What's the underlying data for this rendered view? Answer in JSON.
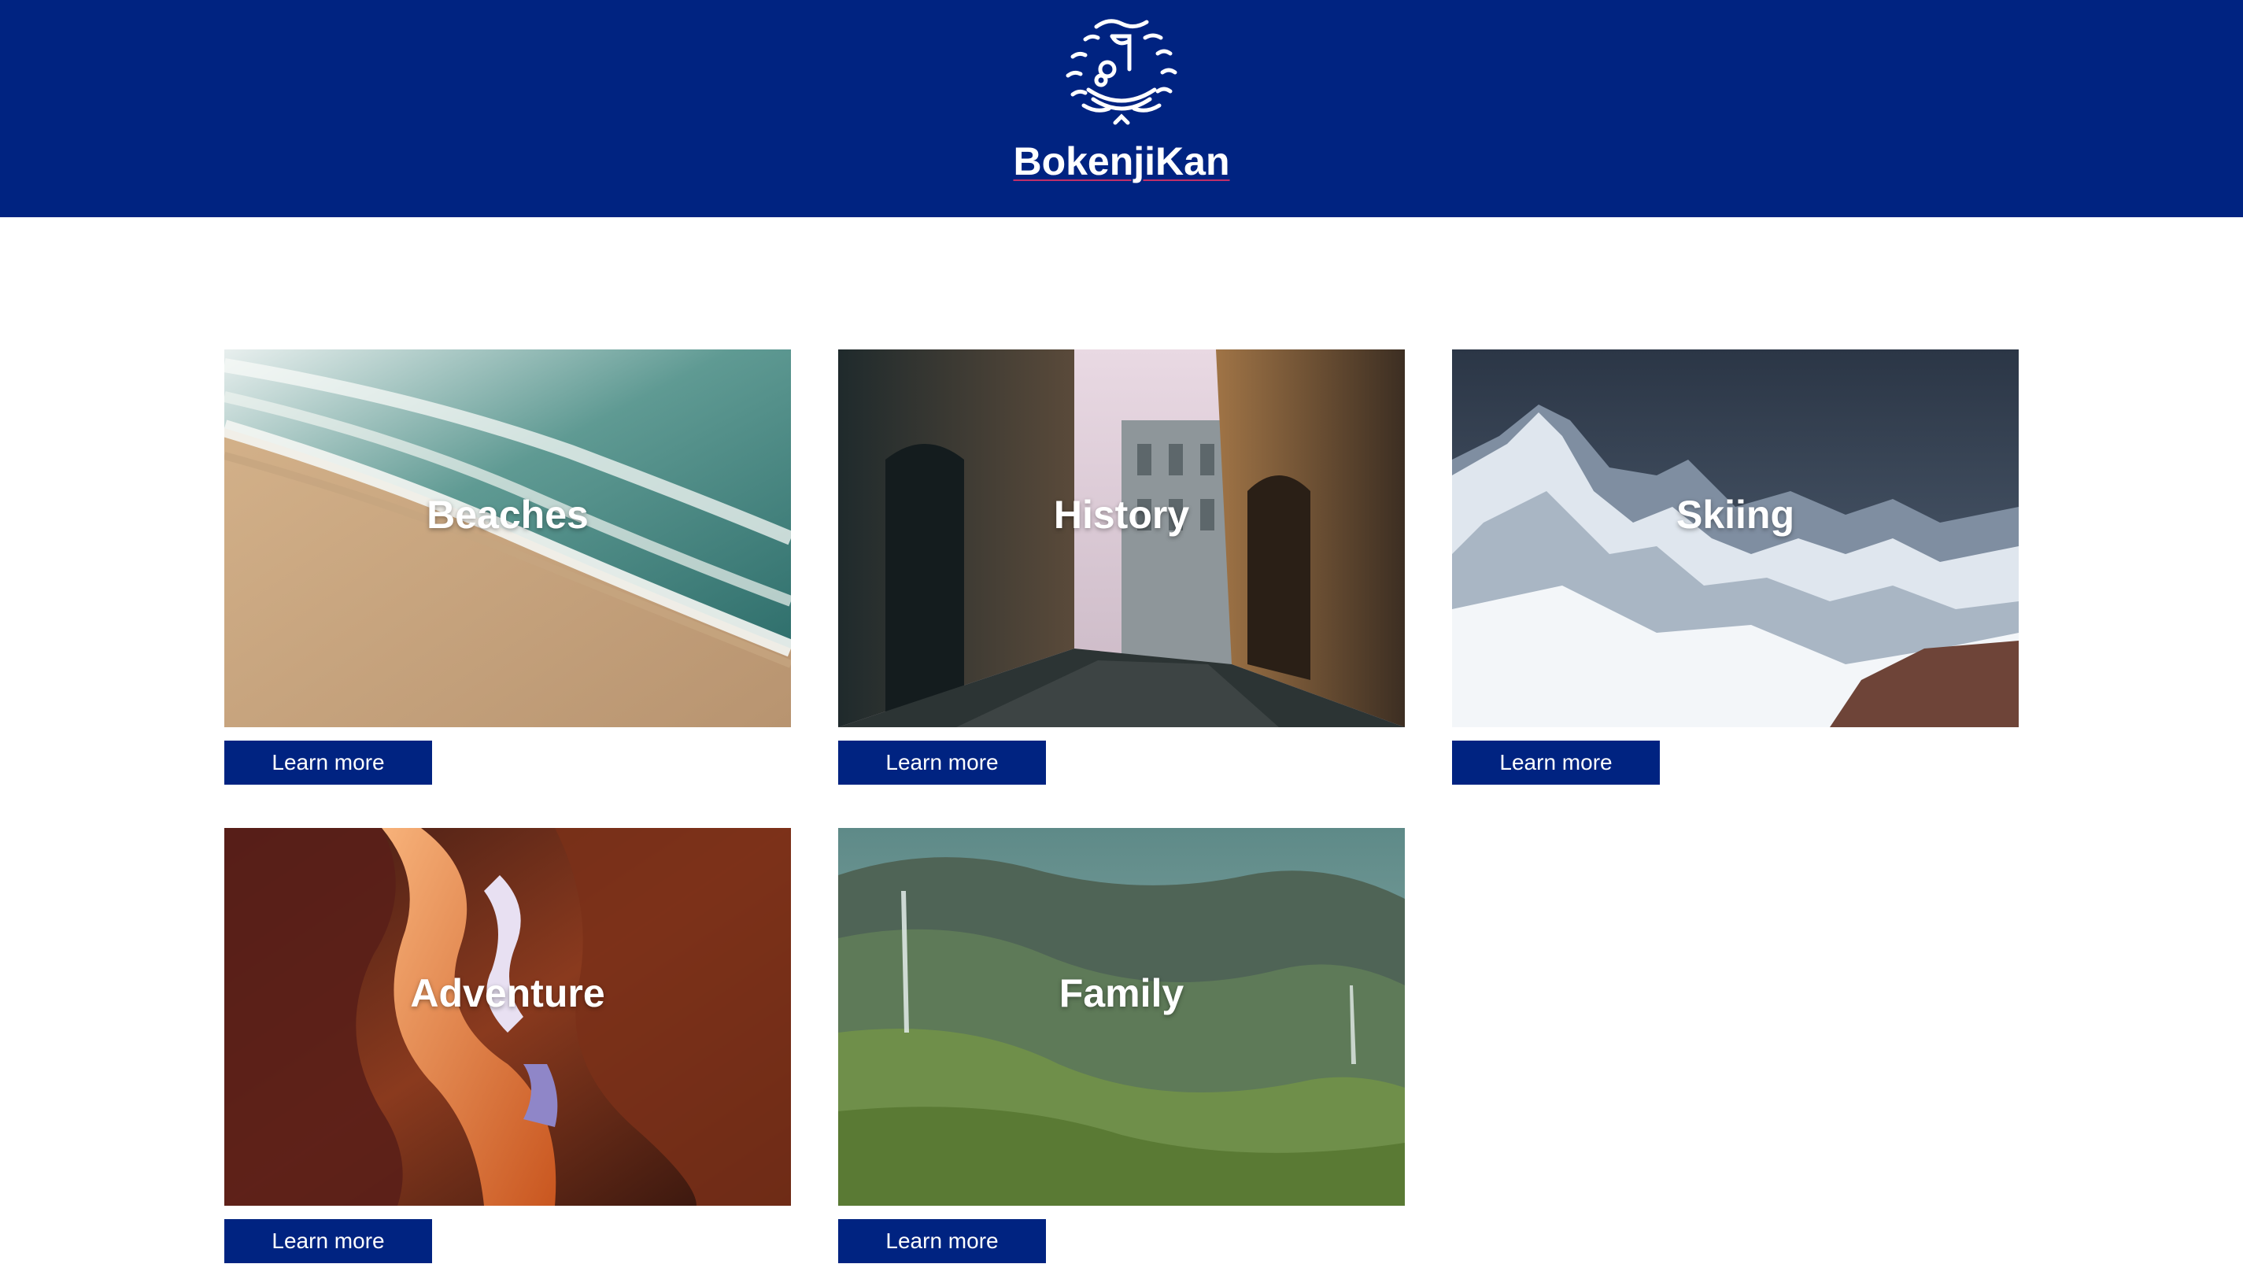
{
  "header": {
    "brand_name": "BokenjiKan",
    "logo_icon": "boat-sun-waves-icon",
    "background_color": "#002381"
  },
  "cards": [
    {
      "title": "Beaches",
      "button_label": "Learn more",
      "image": "beach-waves-photo"
    },
    {
      "title": "History",
      "button_label": "Learn more",
      "image": "old-town-street-photo"
    },
    {
      "title": "Skiing",
      "button_label": "Learn more",
      "image": "snowy-mountains-photo"
    },
    {
      "title": "Adventure",
      "button_label": "Learn more",
      "image": "slot-canyon-photo"
    },
    {
      "title": "Family",
      "button_label": "Learn more",
      "image": "green-valley-photo"
    }
  ],
  "colors": {
    "accent": "#002381",
    "text_on_accent": "#ffffff"
  }
}
